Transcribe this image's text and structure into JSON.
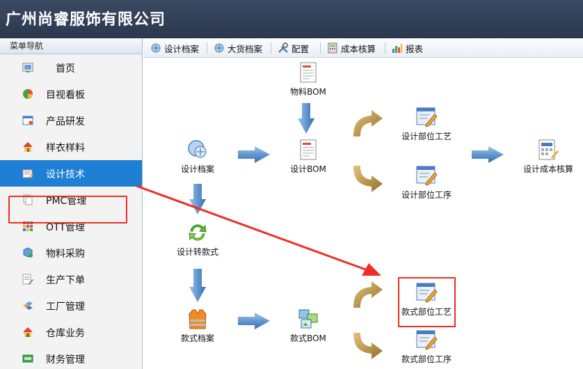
{
  "app": {
    "title": "广州尚睿服饰有限公司"
  },
  "sidebar": {
    "header": "菜单导航",
    "items": [
      {
        "label": "首页",
        "icon": "home-screen-icon"
      },
      {
        "label": "目视看板",
        "icon": "pie-chart-icon"
      },
      {
        "label": "产品研发",
        "icon": "window-icon"
      },
      {
        "label": "样衣样料",
        "icon": "house-icon"
      },
      {
        "label": "设计技术",
        "icon": "design-tech-icon",
        "active": true
      },
      {
        "label": "PMC管理",
        "icon": "documents-icon"
      },
      {
        "label": "OTT管理",
        "icon": "color-grid-icon"
      },
      {
        "label": "物料采购",
        "icon": "box-cart-icon"
      },
      {
        "label": "生产下单",
        "icon": "edit-document-icon"
      },
      {
        "label": "工厂管理",
        "icon": "factory-blocks-icon"
      },
      {
        "label": "仓库业务",
        "icon": "warehouse-icon"
      },
      {
        "label": "财务管理",
        "icon": "finance-icon"
      }
    ]
  },
  "toolbar": {
    "items": [
      {
        "label": "设计档案",
        "icon": "design-archive-icon"
      },
      {
        "label": "大货档案",
        "icon": "bulk-archive-icon"
      },
      {
        "label": "配置",
        "icon": "tools-icon"
      },
      {
        "label": "成本核算",
        "icon": "calculator-icon"
      },
      {
        "label": "报表",
        "icon": "bar-chart-icon"
      }
    ]
  },
  "flow": {
    "material_bom": "物料BOM",
    "design_archive": "设计档案",
    "design_bom": "设计BOM",
    "design_part_craft": "设计部位工艺",
    "design_part_process": "设计部位工序",
    "design_cost": "设计成本核算",
    "design_to_style": "设计转款式",
    "style_archive": "款式档案",
    "style_bom": "款式BOM",
    "style_part_craft": "款式部位工艺",
    "style_part_process": "款式部位工序"
  },
  "colors": {
    "titlebar": "#2f3c53",
    "active_nav": "#1e7fd4",
    "highlight": "#ef2d22",
    "flow_arrow": "#3f7fc4",
    "curve_arrow": "#b08a3c"
  }
}
